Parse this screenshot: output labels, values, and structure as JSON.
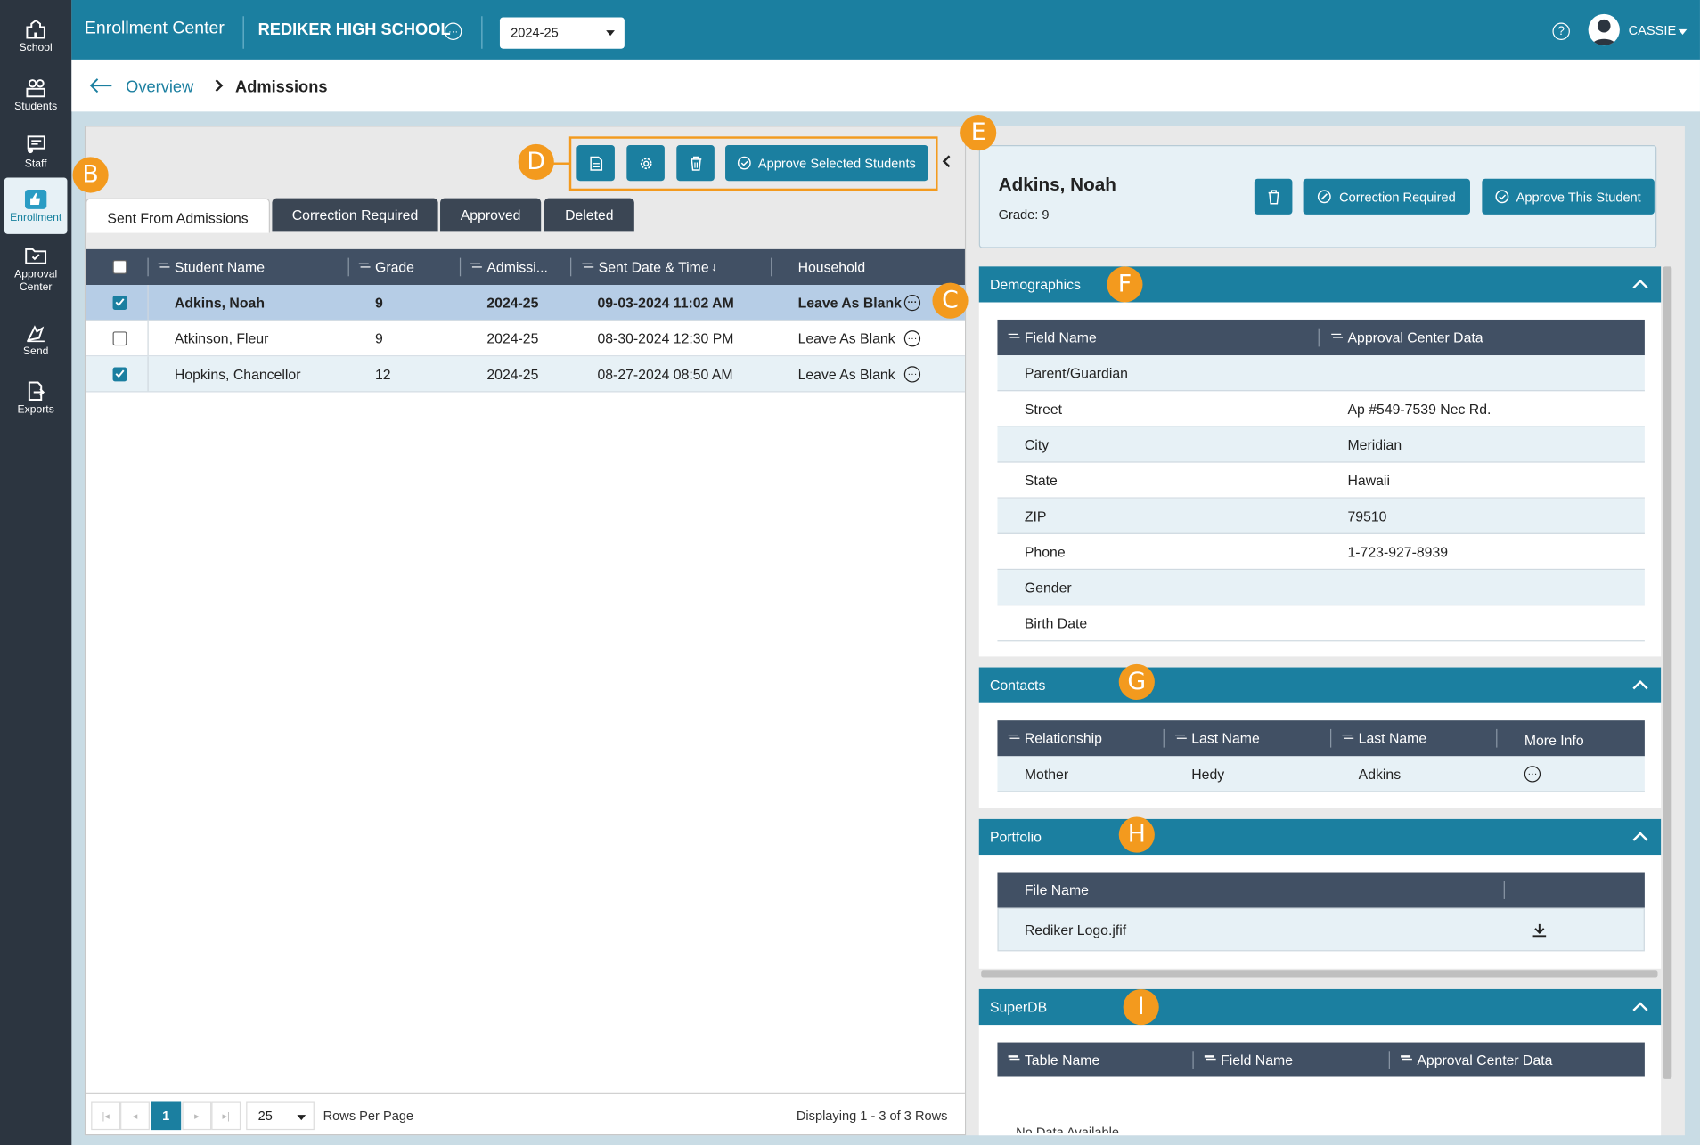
{
  "app": {
    "title": "Enrollment Center",
    "school": "REDIKER HIGH SCHOOL",
    "year": "2024-25",
    "user": "CASSIE"
  },
  "sidebar": {
    "items": [
      {
        "label": "School",
        "icon": "school-icon"
      },
      {
        "label": "Students",
        "icon": "students-icon"
      },
      {
        "label": "Staff",
        "icon": "staff-icon"
      },
      {
        "label": "Enrollment",
        "icon": "thumbs-up-icon"
      },
      {
        "label": "Approval Center",
        "icon": "folder-check-icon"
      },
      {
        "label": "Send",
        "icon": "send-icon"
      },
      {
        "label": "Exports",
        "icon": "export-icon"
      }
    ]
  },
  "breadcrumb": {
    "parent": "Overview",
    "current": "Admissions"
  },
  "toolbar": {
    "approve_selected": "Approve Selected Students"
  },
  "tabs": [
    "Sent From Admissions",
    "Correction Required",
    "Approved",
    "Deleted"
  ],
  "grid": {
    "columns": [
      "Student Name",
      "Grade",
      "Admissi...",
      "Sent Date & Time",
      "Household"
    ],
    "rows": [
      {
        "name": "Adkins, Noah",
        "grade": "9",
        "year": "2024-25",
        "sent": "09-03-2024 11:02 AM",
        "household": "Leave As Blank",
        "checked": true
      },
      {
        "name": "Atkinson, Fleur",
        "grade": "9",
        "year": "2024-25",
        "sent": "08-30-2024 12:30 PM",
        "household": "Leave As Blank",
        "checked": false
      },
      {
        "name": "Hopkins, Chancellor",
        "grade": "12",
        "year": "2024-25",
        "sent": "08-27-2024 08:50 AM",
        "household": "Leave As Blank",
        "checked": true
      }
    ]
  },
  "pager": {
    "page": "1",
    "rows_per_page": "25",
    "rows_label": "Rows Per Page",
    "summary": "Displaying 1 - 3 of 3 Rows"
  },
  "student": {
    "name": "Adkins, Noah",
    "grade": "Grade: 9",
    "correction_btn": "Correction Required",
    "approve_btn": "Approve This Student"
  },
  "demographics": {
    "title": "Demographics",
    "col1": "Field Name",
    "col2": "Approval Center Data",
    "rows": [
      {
        "field": "Parent/Guardian",
        "value": ""
      },
      {
        "field": "Street",
        "value": "Ap #549-7539 Nec Rd."
      },
      {
        "field": "City",
        "value": "Meridian"
      },
      {
        "field": "State",
        "value": "Hawaii"
      },
      {
        "field": "ZIP",
        "value": "79510"
      },
      {
        "field": "Phone",
        "value": "1-723-927-8939"
      },
      {
        "field": "Gender",
        "value": ""
      },
      {
        "field": "Birth Date",
        "value": ""
      }
    ]
  },
  "contacts": {
    "title": "Contacts",
    "cols": [
      "Relationship",
      "Last Name",
      "Last Name",
      "More Info"
    ],
    "rows": [
      {
        "relationship": "Mother",
        "c2": "Hedy",
        "c3": "Adkins"
      }
    ]
  },
  "portfolio": {
    "title": "Portfolio",
    "col": "File Name",
    "rows": [
      {
        "file": "Rediker Logo.jfif"
      }
    ]
  },
  "superdb": {
    "title": "SuperDB",
    "cols": [
      "Table Name",
      "Field Name",
      "Approval Center Data"
    ],
    "empty": "No Data Available"
  },
  "callouts": [
    "B",
    "C",
    "D",
    "E",
    "F",
    "G",
    "H",
    "I"
  ]
}
